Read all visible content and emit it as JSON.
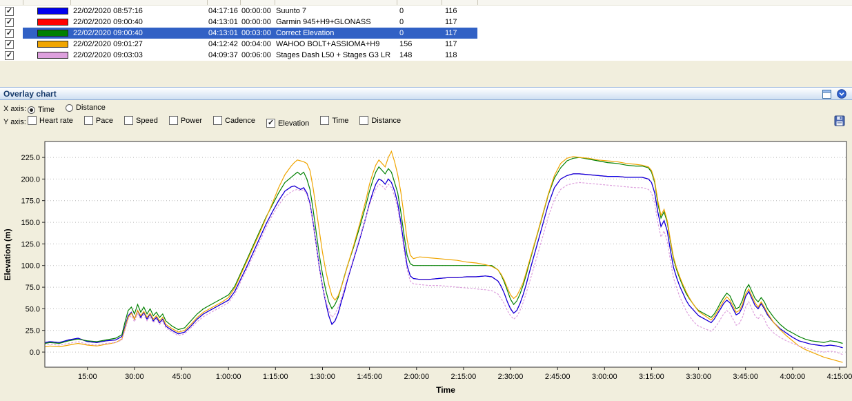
{
  "panel": {
    "title": "Overlay chart"
  },
  "icons": {
    "restore": "panel-window-icon",
    "collapse": "chevron-down-circle-icon",
    "save": "floppy-disk-icon"
  },
  "table": {
    "rows": [
      {
        "checked": true,
        "selected": false,
        "color": "#0000ee",
        "datetime": "22/02/2020 08:57:16",
        "duration": "04:17:16",
        "offset": "00:00:00",
        "name": "Suunto 7",
        "v1": "0",
        "v2": "116"
      },
      {
        "checked": true,
        "selected": false,
        "color": "#ff0000",
        "datetime": "22/02/2020 09:00:40",
        "duration": "04:13:01",
        "offset": "00:00:00",
        "name": "Garmin 945+H9+GLONASS",
        "v1": "0",
        "v2": "117"
      },
      {
        "checked": true,
        "selected": true,
        "color": "#008000",
        "datetime": "22/02/2020 09:00:40",
        "duration": "04:13:01",
        "offset": "00:03:00",
        "name": "Correct Elevation",
        "v1": "0",
        "v2": "117"
      },
      {
        "checked": true,
        "selected": false,
        "color": "#f0a500",
        "datetime": "22/02/2020 09:01:27",
        "duration": "04:12:42",
        "offset": "00:04:00",
        "name": "WAHOO BOLT+ASSIOMA+H9",
        "v1": "156",
        "v2": "117"
      },
      {
        "checked": true,
        "selected": false,
        "color": "#dda0dd",
        "datetime": "22/02/2020 09:03:03",
        "duration": "04:09:37",
        "offset": "00:06:00",
        "name": "Stages Dash L50 + Stages G3 LR",
        "v1": "148",
        "v2": "118"
      }
    ]
  },
  "controls": {
    "x_axis_label": "X axis:",
    "x_options": [
      {
        "label": "Time",
        "selected": true
      },
      {
        "label": "Distance",
        "selected": false
      }
    ],
    "y_axis_label": "Y axis:",
    "y_options": [
      {
        "label": "Heart rate",
        "checked": false
      },
      {
        "label": "Pace",
        "checked": false
      },
      {
        "label": "Speed",
        "checked": false
      },
      {
        "label": "Power",
        "checked": false
      },
      {
        "label": "Cadence",
        "checked": false
      },
      {
        "label": "Elevation",
        "checked": true
      },
      {
        "label": "Time",
        "checked": false
      },
      {
        "label": "Distance",
        "checked": false
      }
    ]
  },
  "chart_data": {
    "type": "line",
    "title": "",
    "xlabel": "Time",
    "ylabel": "Elevation (m)",
    "grid": "horizontal-dotted",
    "legend": "none",
    "ylim": [
      -17.5,
      243.4
    ],
    "xlim_minutes": [
      1.4,
      257.2
    ],
    "y_ticks": [
      0,
      25,
      50,
      75,
      100,
      125,
      150,
      175,
      200,
      225
    ],
    "x_ticks": [
      {
        "t": 15,
        "label": "15:00"
      },
      {
        "t": 30,
        "label": "30:00"
      },
      {
        "t": 45,
        "label": "45:00"
      },
      {
        "t": 60,
        "label": "1:00:00"
      },
      {
        "t": 75,
        "label": "1:15:00"
      },
      {
        "t": 90,
        "label": "1:30:00"
      },
      {
        "t": 105,
        "label": "1:45:00"
      },
      {
        "t": 120,
        "label": "2:00:00"
      },
      {
        "t": 135,
        "label": "2:15:00"
      },
      {
        "t": 150,
        "label": "2:30:00"
      },
      {
        "t": 165,
        "label": "2:45:00"
      },
      {
        "t": 180,
        "label": "3:00:00"
      },
      {
        "t": 195,
        "label": "3:15:00"
      },
      {
        "t": 210,
        "label": "3:30:00"
      },
      {
        "t": 225,
        "label": "3:45:00"
      },
      {
        "t": 240,
        "label": "4:00:00"
      },
      {
        "t": 255,
        "label": "4:15:00"
      }
    ],
    "t": [
      0,
      3,
      6,
      9,
      12,
      15,
      18,
      21,
      24,
      26,
      27,
      28,
      29,
      30,
      31,
      32,
      33,
      34,
      35,
      36,
      37,
      38,
      39,
      40,
      42,
      44,
      46,
      48,
      50,
      52,
      54,
      56,
      58,
      60,
      62,
      64,
      66,
      68,
      70,
      72,
      74,
      76,
      78,
      80,
      81,
      82,
      83,
      84,
      85,
      86,
      87,
      88,
      89,
      90,
      91,
      92,
      93,
      94,
      95,
      96,
      97,
      98,
      100,
      102,
      104,
      105,
      106,
      107,
      108,
      109,
      110,
      111,
      112,
      113,
      114,
      115,
      116,
      117,
      118,
      119,
      121,
      124,
      127,
      130,
      133,
      136,
      139,
      142,
      144,
      146,
      147,
      148,
      149,
      150,
      151,
      152,
      153,
      154,
      155,
      156,
      158,
      160,
      162,
      164,
      166,
      168,
      170,
      172,
      175,
      178,
      181,
      184,
      187,
      190,
      192,
      194,
      195,
      196,
      197,
      198,
      199,
      200,
      201,
      202,
      203,
      204,
      205,
      206,
      207,
      208,
      209,
      210,
      212,
      214,
      215,
      216,
      217,
      218,
      219,
      220,
      221,
      222,
      223,
      224,
      225,
      226,
      227,
      228,
      229,
      230,
      231,
      232,
      234,
      236,
      238,
      240,
      242,
      244,
      246,
      248,
      250,
      252,
      254,
      256
    ],
    "series": [
      {
        "name": "Garmin 945+H9+GLONASS",
        "color": "#ff0000",
        "v": [
          10,
          12,
          11,
          14,
          16,
          12,
          11,
          13,
          14,
          18,
          30,
          42,
          46,
          38,
          48,
          40,
          46,
          38,
          44,
          36,
          40,
          34,
          38,
          30,
          25,
          21,
          23,
          30,
          38,
          44,
          48,
          52,
          56,
          60,
          70,
          85,
          100,
          116,
          132,
          148,
          162,
          175,
          186,
          191,
          192,
          190,
          188,
          190,
          184,
          172,
          150,
          124,
          98,
          76,
          58,
          42,
          32,
          36,
          45,
          58,
          70,
          84,
          108,
          132,
          158,
          172,
          184,
          194,
          200,
          198,
          194,
          200,
          196,
          186,
          172,
          150,
          124,
          100,
          88,
          85,
          84,
          84,
          85,
          86,
          86,
          87,
          87,
          88,
          87,
          82,
          76,
          68,
          58,
          50,
          45,
          48,
          56,
          66,
          78,
          92,
          118,
          144,
          170,
          190,
          200,
          204,
          206,
          206,
          205,
          204,
          203,
          203,
          202,
          202,
          202,
          200,
          196,
          184,
          162,
          145,
          152,
          140,
          118,
          98,
          86,
          76,
          68,
          60,
          54,
          50,
          46,
          42,
          38,
          34,
          38,
          44,
          50,
          56,
          60,
          57,
          50,
          43,
          45,
          52,
          64,
          70,
          62,
          54,
          50,
          56,
          50,
          43,
          34,
          27,
          22,
          17,
          13,
          11,
          9,
          8,
          7,
          8,
          7,
          5
        ]
      },
      {
        "name": "Suunto 7",
        "color": "#0000ee",
        "v": [
          10,
          12,
          11,
          14,
          16,
          12,
          11,
          13,
          14,
          18,
          30,
          42,
          46,
          38,
          48,
          40,
          46,
          38,
          44,
          36,
          40,
          34,
          38,
          30,
          25,
          21,
          23,
          30,
          38,
          44,
          48,
          52,
          56,
          60,
          70,
          85,
          100,
          116,
          132,
          148,
          162,
          175,
          186,
          191,
          192,
          190,
          188,
          190,
          184,
          172,
          150,
          124,
          98,
          76,
          58,
          42,
          32,
          36,
          45,
          58,
          70,
          84,
          108,
          132,
          158,
          172,
          184,
          194,
          200,
          198,
          194,
          200,
          196,
          186,
          172,
          150,
          124,
          100,
          88,
          85,
          84,
          84,
          85,
          86,
          86,
          87,
          87,
          88,
          87,
          82,
          76,
          68,
          58,
          50,
          45,
          48,
          56,
          66,
          78,
          92,
          118,
          144,
          170,
          190,
          200,
          204,
          206,
          206,
          205,
          204,
          203,
          203,
          202,
          202,
          202,
          200,
          196,
          184,
          162,
          145,
          152,
          140,
          118,
          98,
          86,
          76,
          68,
          60,
          54,
          50,
          46,
          42,
          38,
          34,
          38,
          44,
          50,
          56,
          60,
          57,
          50,
          43,
          45,
          52,
          64,
          70,
          62,
          54,
          50,
          56,
          50,
          43,
          34,
          27,
          22,
          17,
          13,
          11,
          9,
          8,
          7,
          8,
          7,
          5
        ]
      },
      {
        "name": "Correct Elevation",
        "color": "#008000",
        "v": [
          9,
          11,
          10,
          13,
          15,
          13,
          12,
          14,
          16,
          20,
          35,
          48,
          52,
          44,
          55,
          46,
          52,
          44,
          50,
          42,
          46,
          40,
          44,
          36,
          30,
          26,
          28,
          36,
          44,
          50,
          54,
          58,
          62,
          66,
          76,
          92,
          108,
          124,
          140,
          156,
          170,
          184,
          196,
          202,
          205,
          208,
          205,
          208,
          200,
          188,
          165,
          138,
          112,
          90,
          72,
          58,
          50,
          55,
          63,
          75,
          88,
          100,
          122,
          146,
          172,
          186,
          198,
          208,
          214,
          210,
          206,
          212,
          208,
          196,
          184,
          162,
          136,
          112,
          102,
          100,
          100,
          100,
          100,
          100,
          100,
          100,
          100,
          100,
          100,
          95,
          89,
          81,
          71,
          61,
          55,
          59,
          67,
          77,
          89,
          103,
          129,
          155,
          181,
          201,
          213,
          221,
          224,
          225,
          223,
          221,
          219,
          218,
          216,
          215,
          215,
          213,
          208,
          196,
          172,
          155,
          162,
          150,
          128,
          108,
          95,
          85,
          76,
          68,
          62,
          57,
          52,
          48,
          44,
          40,
          44,
          50,
          57,
          63,
          68,
          65,
          57,
          50,
          52,
          60,
          72,
          78,
          70,
          62,
          58,
          63,
          58,
          50,
          40,
          32,
          26,
          22,
          18,
          15,
          13,
          12,
          11,
          13,
          12,
          10
        ]
      },
      {
        "name": "WAHOO BOLT+ASSIOMA+H9",
        "color": "#f0a500",
        "v": [
          5,
          7,
          6,
          8,
          10,
          8,
          7,
          9,
          11,
          15,
          28,
          40,
          45,
          38,
          48,
          42,
          47,
          40,
          45,
          38,
          42,
          36,
          40,
          32,
          27,
          23,
          25,
          32,
          40,
          46,
          50,
          54,
          58,
          63,
          74,
          90,
          106,
          122,
          138,
          155,
          172,
          190,
          205,
          215,
          219,
          222,
          221,
          220,
          218,
          210,
          190,
          165,
          140,
          115,
          95,
          78,
          65,
          60,
          65,
          75,
          87,
          100,
          124,
          150,
          178,
          194,
          206,
          216,
          222,
          218,
          214,
          225,
          232,
          220,
          205,
          185,
          158,
          130,
          112,
          108,
          110,
          109,
          108,
          107,
          106,
          104,
          103,
          101,
          99,
          95,
          90,
          83,
          74,
          66,
          62,
          65,
          72,
          80,
          92,
          105,
          130,
          156,
          182,
          204,
          218,
          224,
          226,
          225,
          224,
          222,
          221,
          220,
          218,
          217,
          216,
          214,
          210,
          198,
          175,
          158,
          165,
          152,
          130,
          110,
          97,
          87,
          78,
          70,
          63,
          57,
          52,
          47,
          42,
          37,
          41,
          47,
          53,
          59,
          64,
          60,
          53,
          46,
          48,
          55,
          67,
          73,
          65,
          57,
          52,
          58,
          52,
          45,
          34,
          26,
          19,
          13,
          7,
          3,
          0,
          -3,
          -6,
          -8,
          -10,
          -12
        ]
      },
      {
        "name": "Stages Dash L50 + Stages G3 LR",
        "color": "#dda0dd",
        "dash": "3,2",
        "v": [
          8,
          9,
          8,
          10,
          12,
          9,
          8,
          10,
          11,
          14,
          26,
          38,
          42,
          35,
          44,
          38,
          43,
          36,
          41,
          34,
          38,
          32,
          36,
          28,
          23,
          19,
          21,
          28,
          35,
          41,
          45,
          49,
          53,
          57,
          67,
          82,
          97,
          112,
          128,
          144,
          158,
          170,
          180,
          185,
          187,
          188,
          186,
          188,
          182,
          170,
          148,
          122,
          96,
          76,
          60,
          48,
          40,
          44,
          52,
          62,
          74,
          86,
          110,
          134,
          158,
          170,
          180,
          188,
          194,
          192,
          188,
          194,
          190,
          180,
          166,
          144,
          118,
          95,
          82,
          79,
          78,
          77,
          77,
          76,
          75,
          74,
          73,
          72,
          71,
          67,
          62,
          56,
          48,
          42,
          38,
          41,
          48,
          57,
          68,
          80,
          105,
          130,
          156,
          176,
          188,
          193,
          195,
          196,
          195,
          194,
          193,
          192,
          191,
          190,
          190,
          188,
          184,
          172,
          150,
          133,
          140,
          128,
          106,
          86,
          74,
          64,
          56,
          48,
          42,
          37,
          33,
          30,
          27,
          24,
          27,
          32,
          38,
          44,
          48,
          45,
          38,
          31,
          33,
          40,
          52,
          58,
          50,
          42,
          38,
          44,
          38,
          30,
          22,
          17,
          13,
          10,
          7,
          5,
          3,
          1,
          0,
          1,
          0,
          -3
        ]
      }
    ]
  }
}
